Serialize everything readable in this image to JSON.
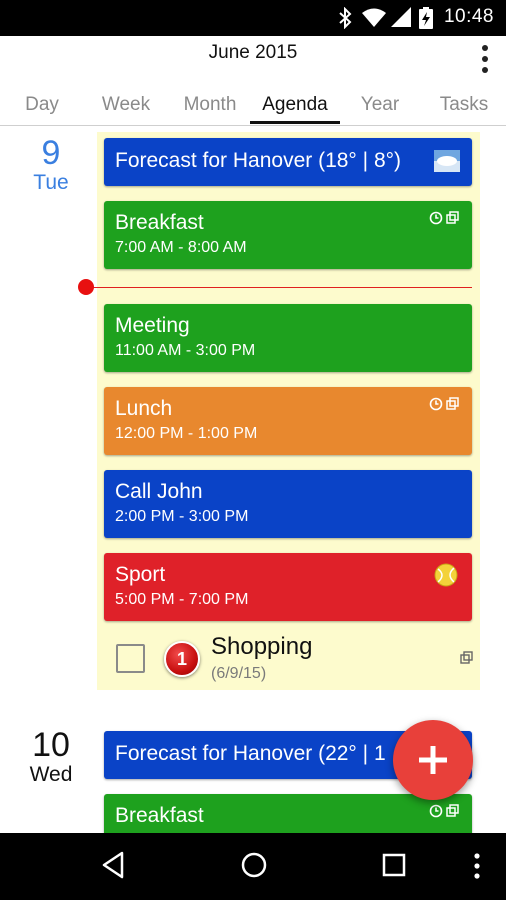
{
  "status_bar": {
    "time": "10:48",
    "icons": [
      "bluetooth-icon",
      "wifi-icon",
      "signal-icon",
      "battery-charging-icon"
    ]
  },
  "header": {
    "title": "June 2015",
    "overflow_icon": "more-vert-icon"
  },
  "tabs": [
    {
      "label": "Day",
      "active": false
    },
    {
      "label": "Week",
      "active": false
    },
    {
      "label": "Month",
      "active": false
    },
    {
      "label": "Agenda",
      "active": true
    },
    {
      "label": "Year",
      "active": false
    },
    {
      "label": "Tasks",
      "active": false
    }
  ],
  "colors": {
    "today_accent": "#3a7fe0",
    "day_background": "#fdfbcd",
    "event_blue": "#0a43c7",
    "event_green": "#1ea11e",
    "event_orange": "#e8882e",
    "event_red": "#df2129",
    "now_line": "#e02020",
    "fab": "#e8403a"
  },
  "days": [
    {
      "number": "9",
      "weekday": "Tue",
      "events": [
        {
          "title": "Forecast for Hanover (18° | 8°)",
          "time": "",
          "color": "blue",
          "icons": [
            "weather-cloud-icon"
          ]
        },
        {
          "title": "Breakfast",
          "time": "7:00 AM - 8:00 AM",
          "color": "green",
          "icons": [
            "alarm-icon",
            "copy-icon"
          ]
        },
        {
          "title": "Meeting",
          "time": "11:00 AM - 3:00 PM",
          "color": "green",
          "icons": []
        },
        {
          "title": "Lunch",
          "time": "12:00 PM - 1:00 PM",
          "color": "orange",
          "icons": [
            "alarm-icon",
            "copy-icon"
          ]
        },
        {
          "title": "Call John",
          "time": "2:00 PM - 3:00 PM",
          "color": "blue",
          "icons": []
        },
        {
          "title": "Sport",
          "time": "5:00 PM - 7:00 PM",
          "color": "red",
          "icons": [
            "tennis-ball-icon"
          ]
        }
      ],
      "task": {
        "title": "Shopping",
        "date": "(6/9/15)",
        "priority": "1",
        "checked": false
      }
    },
    {
      "number": "10",
      "weekday": "Wed",
      "events": [
        {
          "title": "Forecast for Hanover (22° | 1",
          "time": "",
          "color": "blue"
        },
        {
          "title": "Breakfast",
          "time": "",
          "color": "green",
          "icons": [
            "alarm-icon",
            "copy-icon"
          ]
        }
      ]
    }
  ],
  "fab": {
    "icon": "plus-icon"
  },
  "nav_bar": {
    "buttons": [
      "back-icon",
      "home-icon",
      "recents-icon",
      "more-vert-icon"
    ]
  }
}
